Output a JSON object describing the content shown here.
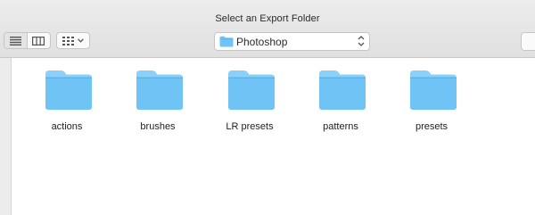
{
  "window": {
    "title": "Select an Export Folder"
  },
  "toolbar": {
    "view_list_icon": "list-view-icon",
    "view_column_icon": "column-view-icon",
    "arrange_icon": "grid-arrange-icon",
    "path_label": "Photoshop"
  },
  "folders": [
    {
      "name": "actions"
    },
    {
      "name": "brushes"
    },
    {
      "name": "LR presets"
    },
    {
      "name": "patterns"
    },
    {
      "name": "presets"
    }
  ],
  "colors": {
    "folder_body": "#6fc3f5",
    "folder_tab": "#8ad0f8",
    "folder_shade": "#5ab5ec"
  }
}
